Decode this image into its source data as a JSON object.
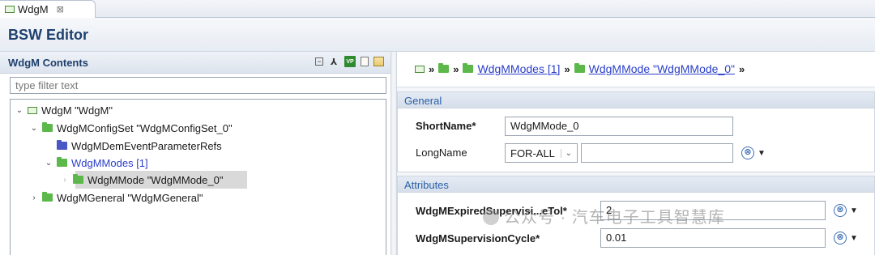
{
  "tab": {
    "title": "WdgM",
    "close": "⊠"
  },
  "header": {
    "title": "BSW Editor"
  },
  "left": {
    "title": "WdgM Contents",
    "filter_placeholder": "type filter text",
    "tree": [
      {
        "label": "WdgM \"WdgM\""
      },
      {
        "label": "WdgMConfigSet \"WdgMConfigSet_0\""
      },
      {
        "label": "WdgMDemEventParameterRefs"
      },
      {
        "label": "WdgMModes [1]"
      },
      {
        "label": "WdgMMode \"WdgMMode_0\""
      },
      {
        "label": "WdgMGeneral \"WdgMGeneral\""
      }
    ]
  },
  "breadcrumb": {
    "link1": "WdgMModes [1]",
    "link2": "WdgMMode \"WdgMMode_0\""
  },
  "general": {
    "title": "General",
    "shortname_label": "ShortName*",
    "shortname_value": "WdgMMode_0",
    "longname_label": "LongName",
    "lang_value": "FOR-ALL",
    "longname_value": ""
  },
  "attributes": {
    "title": "Attributes",
    "expired_label": "WdgMExpiredSupervisi...eTol*",
    "expired_value": "2",
    "cycle_label": "WdgMSupervisionCycle*",
    "cycle_value": "0.01"
  },
  "watermark": "公众号 · 汽车电子工具智慧库",
  "colors": {
    "accent": "#1f3f6e",
    "link": "#2a3fc9",
    "folder_green": "#5cb84a",
    "folder_blue": "#4b57c4"
  }
}
